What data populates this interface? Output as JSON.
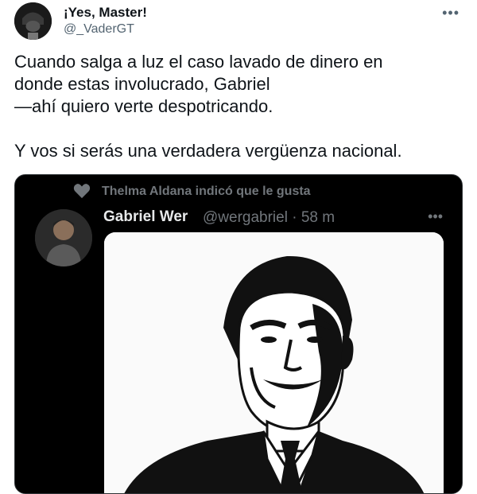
{
  "tweet": {
    "author_name": "¡Yes, Master!",
    "author_handle": "@_VaderGT",
    "text": "Cuando salga a luz el caso lavado de dinero en\ndonde estas involucrado, Gabriel\n—ahí quiero verte despotricando.\n\nY vos si serás una verdadera vergüenza nacional.",
    "more_icon": "more-horizontal-icon"
  },
  "quoted": {
    "liked_by_text": "Thelma Aldana indicó que le gusta",
    "author_name": "Gabriel Wer",
    "author_handle_time": "@wergabriel · 58 m",
    "more_icon": "more-horizontal-icon"
  },
  "colors": {
    "text": "#0f1419",
    "secondary": "#536471",
    "card_bg": "#000000",
    "card_text": "#e7e9ea",
    "card_secondary": "#71767b"
  }
}
